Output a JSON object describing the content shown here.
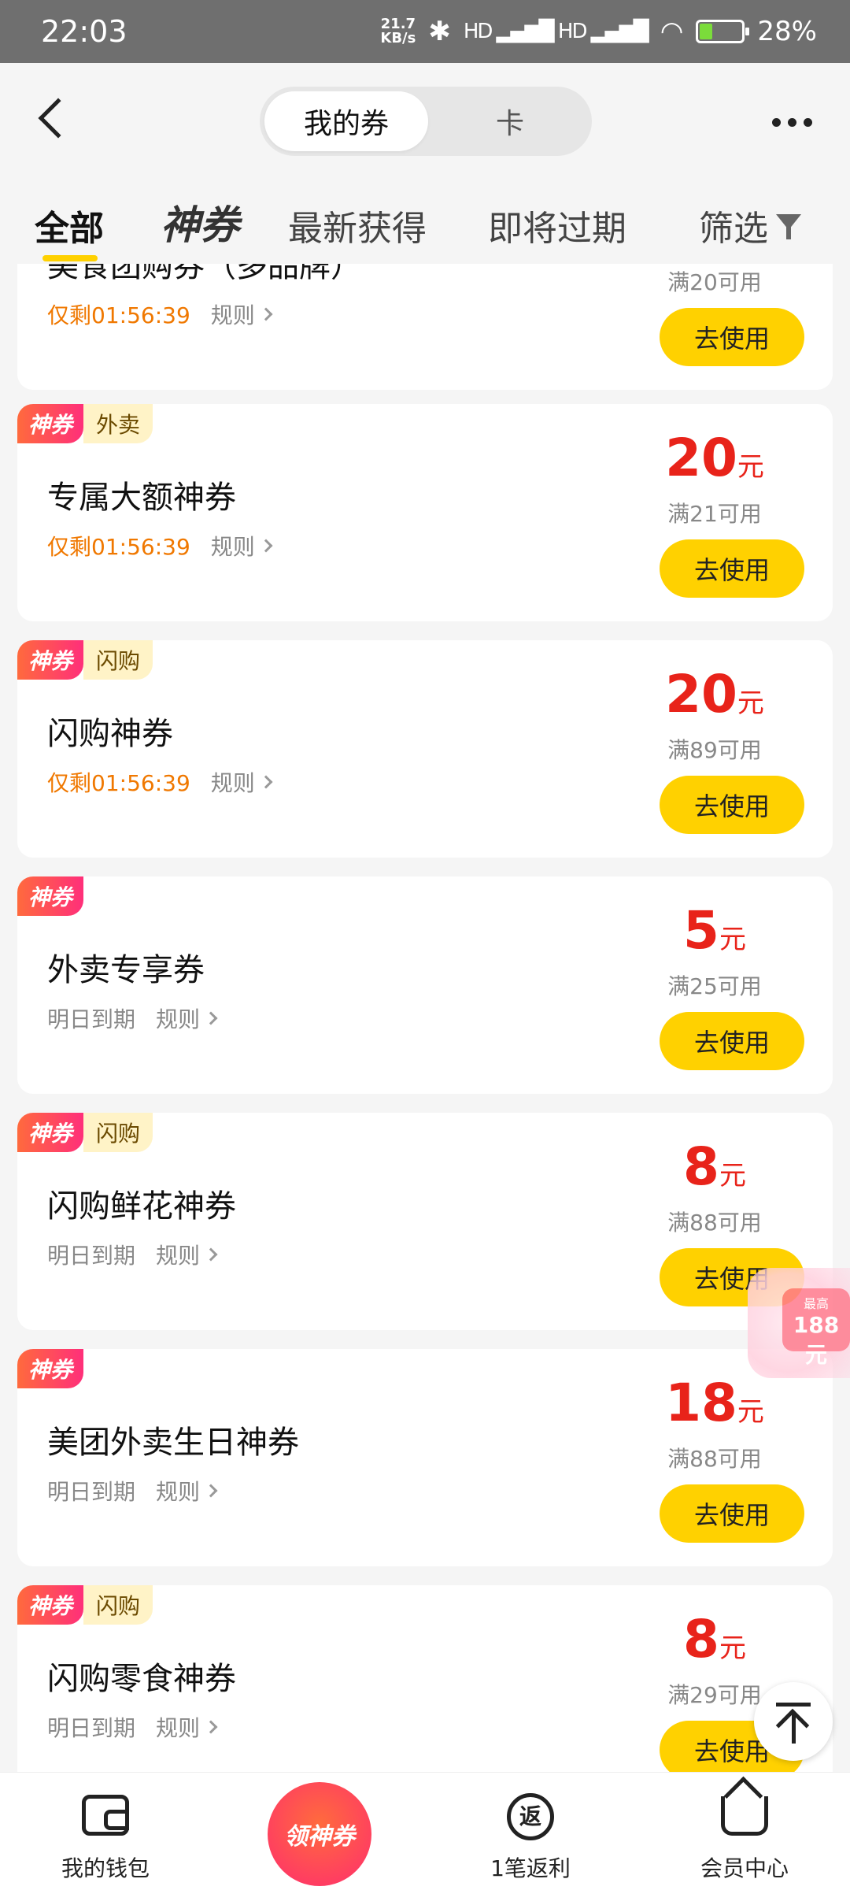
{
  "status": {
    "time": "22:03",
    "net_speed": "21.7",
    "net_unit": "KB/s",
    "signal": "HD ▂▄▆█ HD ▂▄▆█",
    "battery": "28%"
  },
  "header": {
    "tab_coupons": "我的券",
    "tab_cards": "卡"
  },
  "filters": {
    "all": "全部",
    "shen": "神券",
    "newest": "最新获得",
    "expiring": "即将过期",
    "filter": "筛选"
  },
  "coupons": [
    {
      "badge": "",
      "type": "",
      "title": "美食团购券（多品牌）",
      "countdown": "仅剩01:56:39",
      "expire": "",
      "rule": "规则",
      "amount": "",
      "unit": "",
      "condition": "满20可用",
      "button": "去使用"
    },
    {
      "badge": "神券",
      "type": "外卖",
      "title": "专属大额神券",
      "countdown": "仅剩01:56:39",
      "expire": "",
      "rule": "规则",
      "amount": "20",
      "unit": "元",
      "condition": "满21可用",
      "button": "去使用"
    },
    {
      "badge": "神券",
      "type": "闪购",
      "title": "闪购神券",
      "countdown": "仅剩01:56:39",
      "expire": "",
      "rule": "规则",
      "amount": "20",
      "unit": "元",
      "condition": "满89可用",
      "button": "去使用"
    },
    {
      "badge": "神券",
      "type": "",
      "title": "外卖专享券",
      "countdown": "",
      "expire": "明日到期",
      "rule": "规则",
      "amount": "5",
      "unit": "元",
      "condition": "满25可用",
      "button": "去使用"
    },
    {
      "badge": "神券",
      "type": "闪购",
      "title": "闪购鲜花神券",
      "countdown": "",
      "expire": "明日到期",
      "rule": "规则",
      "amount": "8",
      "unit": "元",
      "condition": "满88可用",
      "button": "去使用"
    },
    {
      "badge": "神券",
      "type": "",
      "title": "美团外卖生日神券",
      "countdown": "",
      "expire": "明日到期",
      "rule": "规则",
      "amount": "18",
      "unit": "元",
      "condition": "满88可用",
      "button": "去使用"
    },
    {
      "badge": "神券",
      "type": "闪购",
      "title": "闪购零食神券",
      "countdown": "",
      "expire": "明日到期",
      "rule": "规则",
      "amount": "8",
      "unit": "元",
      "condition": "满29可用",
      "button": "去使用"
    }
  ],
  "promo": {
    "small": "最高",
    "amount": "188元"
  },
  "bottom_nav": {
    "wallet": "我的钱包",
    "center": "领神券",
    "rebate_icon": "返",
    "rebate": "1笔返利",
    "member": "会员中心"
  },
  "colors": {
    "accent": "#ffd100",
    "price": "#e8231a",
    "countdown": "#f07800"
  }
}
